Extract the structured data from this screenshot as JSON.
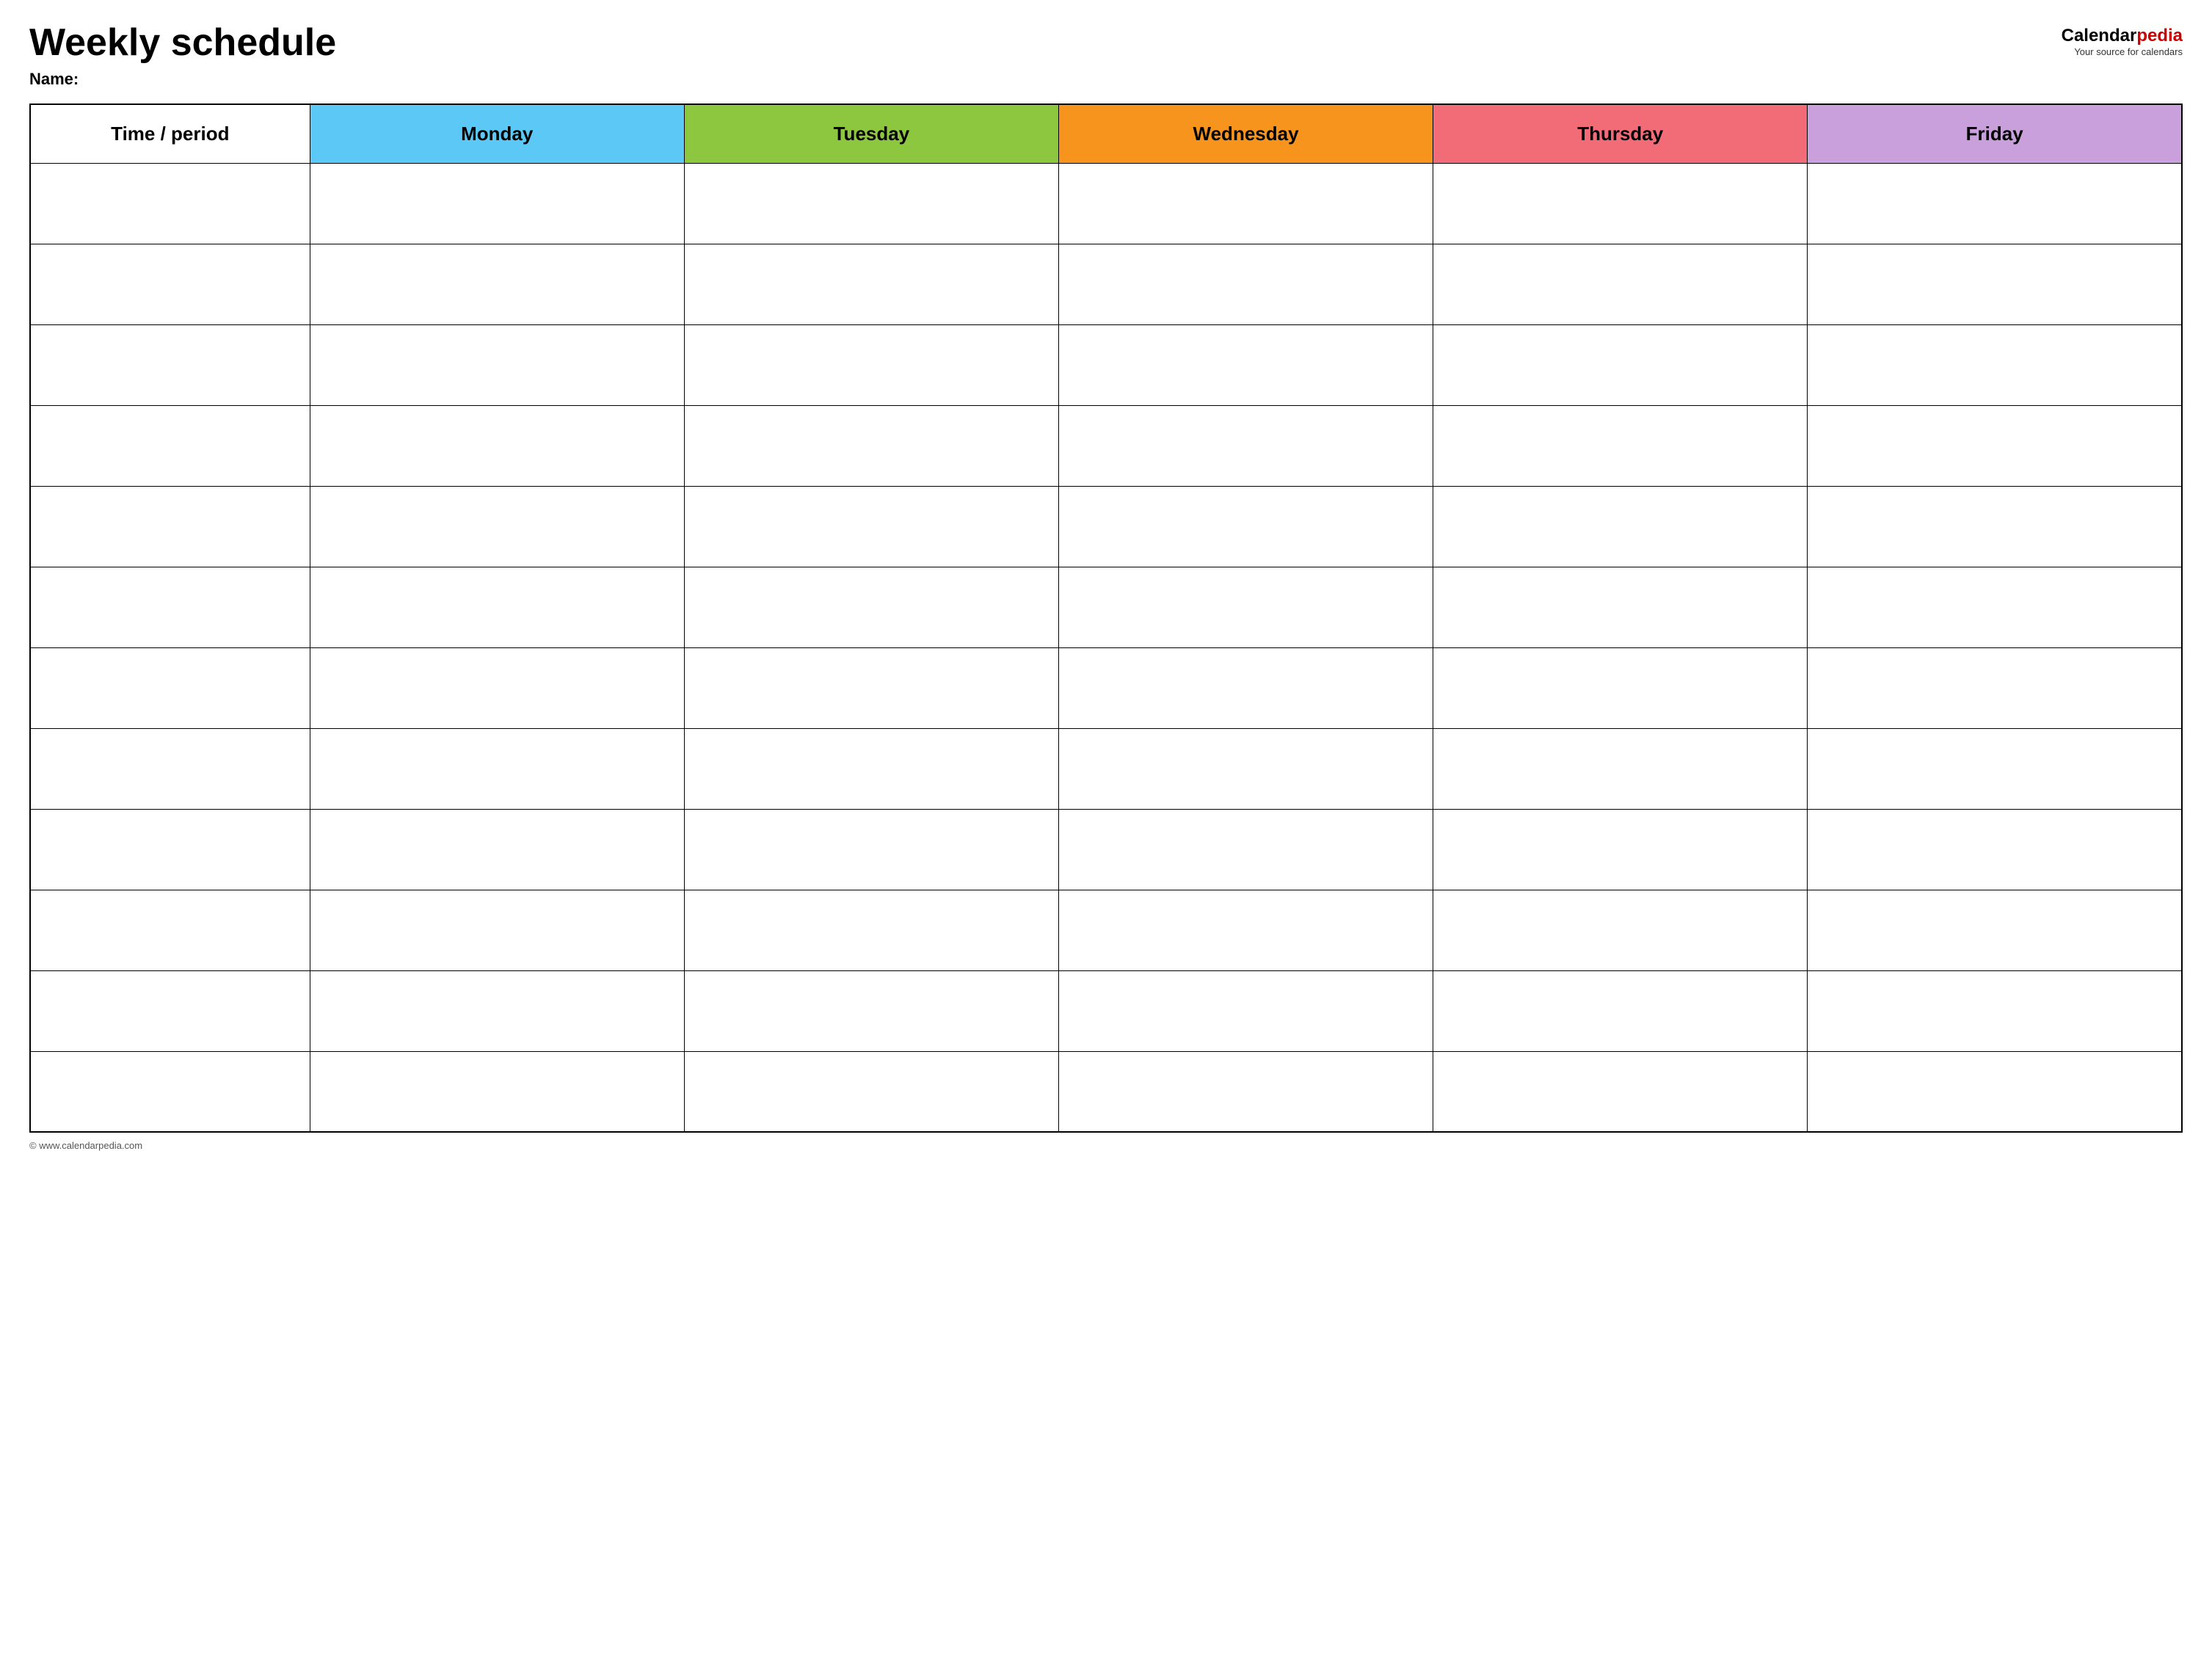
{
  "header": {
    "title": "Weekly schedule",
    "name_label": "Name:",
    "logo": {
      "brand": "Calendar",
      "brand_accent": "pedia",
      "tagline": "Your source for calendars"
    }
  },
  "table": {
    "columns": [
      {
        "id": "time",
        "label": "Time / period",
        "color": "#ffffff"
      },
      {
        "id": "monday",
        "label": "Monday",
        "color": "#5bc8f5"
      },
      {
        "id": "tuesday",
        "label": "Tuesday",
        "color": "#8dc63f"
      },
      {
        "id": "wednesday",
        "label": "Wednesday",
        "color": "#f7941d"
      },
      {
        "id": "thursday",
        "label": "Thursday",
        "color": "#f26c78"
      },
      {
        "id": "friday",
        "label": "Friday",
        "color": "#c9a0dc"
      }
    ],
    "row_count": 12
  },
  "footer": {
    "copyright": "© www.calendarpedia.com"
  }
}
